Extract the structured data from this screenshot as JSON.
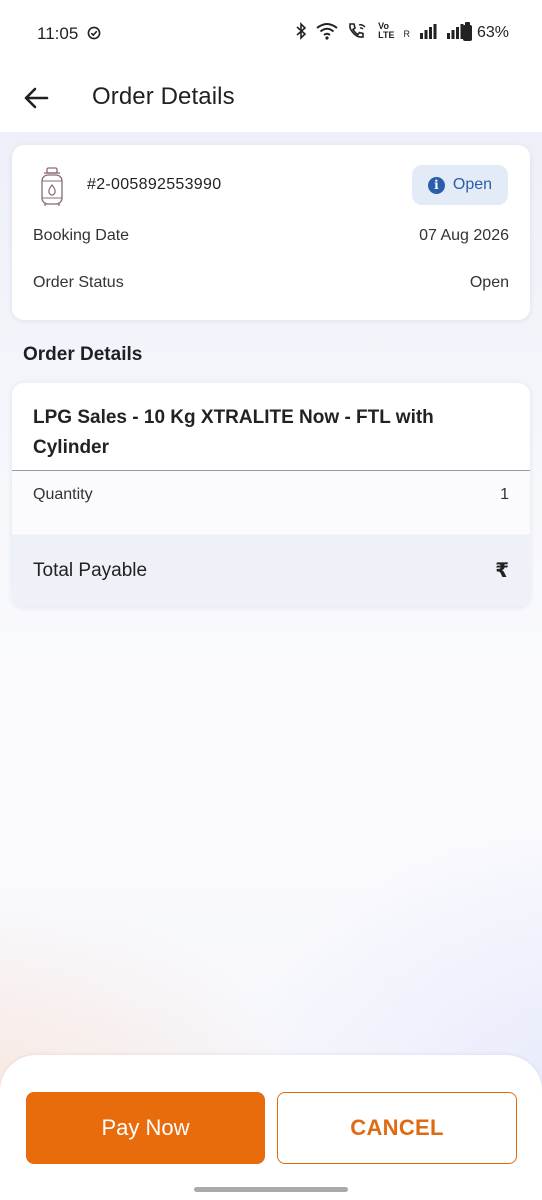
{
  "status_bar": {
    "time": "11:05",
    "battery": "63%",
    "icons": [
      "check-circle-icon",
      "bluetooth-icon",
      "wifi-icon",
      "wifi-call-icon",
      "volte-icon",
      "signal-icon",
      "battery-icon"
    ],
    "volte_top": "Vo",
    "volte_bottom": "LTE",
    "roaming": "R"
  },
  "header": {
    "title": "Order Details",
    "back_icon": "arrow-left-icon"
  },
  "order_card": {
    "order_number": "#2-005892553990",
    "status_chip": {
      "label": "Open",
      "icon": "info-icon",
      "icon_glyph": "i",
      "color": "#2b5dab",
      "bg": "#e3ebf6"
    },
    "rows": [
      {
        "label": "Booking Date",
        "value": "07 Aug 2026"
      },
      {
        "label": "Order Status",
        "value": "Open"
      }
    ]
  },
  "order_details": {
    "section_title": "Order Details",
    "product_name": "LPG Sales - 10 Kg XTRALITE Now - FTL with Cylinder",
    "quantity_label": "Quantity",
    "quantity_value": "1",
    "total_label": "Total Payable",
    "total_value": "₹"
  },
  "actions": {
    "pay_label": "Pay Now",
    "cancel_label": "CANCEL"
  },
  "colors": {
    "accent": "#e86b0c",
    "info_blue": "#2b5dab"
  }
}
